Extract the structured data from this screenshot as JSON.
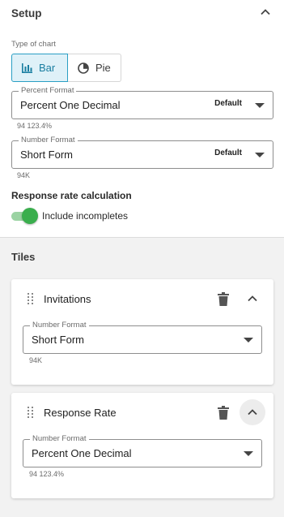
{
  "setup": {
    "title": "Setup",
    "chart_type_label": "Type of chart",
    "chart_types": [
      {
        "label": "Bar",
        "icon": "bar-chart-icon",
        "selected": true
      },
      {
        "label": "Pie",
        "icon": "pie-chart-icon",
        "selected": false
      }
    ],
    "percent_format": {
      "legend": "Percent Format",
      "value": "Percent One Decimal",
      "default_badge": "Default",
      "preview": "94 123.4%"
    },
    "number_format": {
      "legend": "Number Format",
      "value": "Short Form",
      "default_badge": "Default",
      "preview": "94K"
    },
    "response_rate": {
      "title": "Response rate calculation",
      "toggle_label": "Include incompletes",
      "toggle_on": true
    }
  },
  "tiles": {
    "title": "Tiles",
    "items": [
      {
        "name": "Invitations",
        "format_legend": "Number Format",
        "format_value": "Short Form",
        "preview": "94K"
      },
      {
        "name": "Response Rate",
        "format_legend": "Number Format",
        "format_value": "Percent One Decimal",
        "preview": "94 123.4%"
      }
    ]
  },
  "colors": {
    "accent": "#2a9fc4",
    "selected_bg": "#dff1f8",
    "toggle_on": "#3aae4d",
    "panel_bg": "#f2f2f2"
  }
}
